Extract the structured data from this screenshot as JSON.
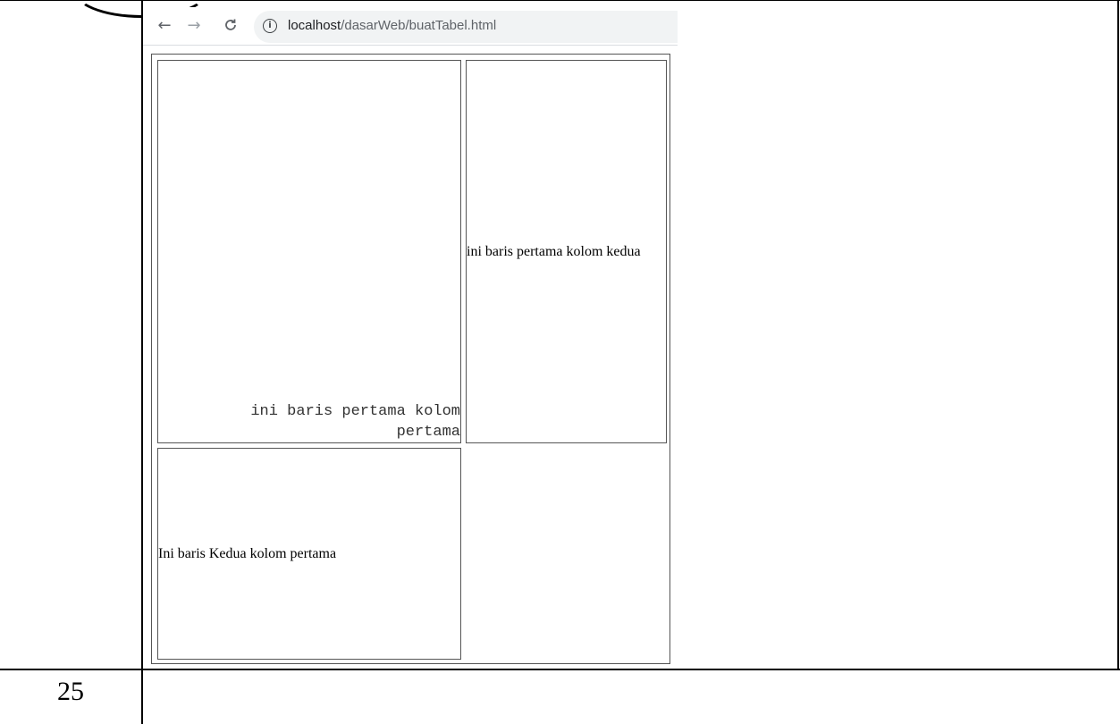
{
  "document": {
    "row_number": "25"
  },
  "browser": {
    "url_host": "localhost",
    "url_path": "/dasarWeb/buatTabel.html",
    "icons": {
      "back": "arrow-left",
      "forward": "arrow-right",
      "reload": "reload",
      "info": "info-circle"
    }
  },
  "table": {
    "row1_col1": "ini baris pertama kolom pertama",
    "row1_col2": "ini baris pertama kolom kedua",
    "row2_col1": "Ini baris Kedua kolom pertama"
  }
}
